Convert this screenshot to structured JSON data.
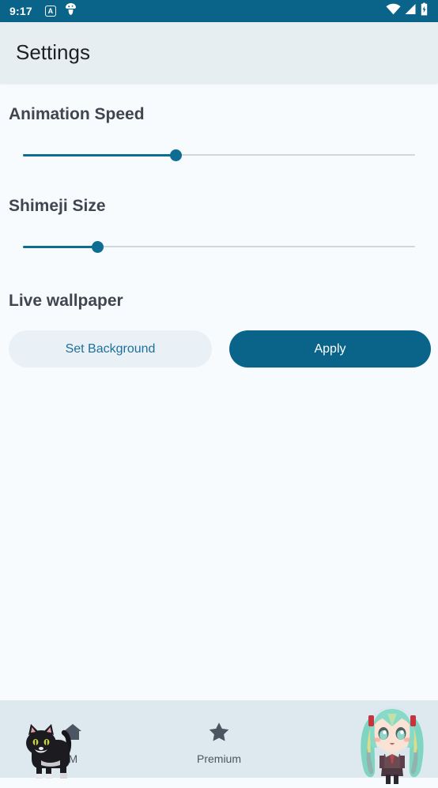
{
  "status_bar": {
    "time": "9:17",
    "left_icons": [
      {
        "name": "a-badge-icon",
        "glyph": "A"
      },
      {
        "name": "mushroom-notification-icon",
        "glyph": "mushroom"
      }
    ],
    "right_icons": [
      {
        "name": "wifi-icon",
        "glyph": "wifi"
      },
      {
        "name": "cellular-signal-icon",
        "glyph": "signal"
      },
      {
        "name": "battery-charging-icon",
        "glyph": "battery-bolt"
      }
    ],
    "background_color": "#0a6489",
    "foreground_color": "#ffffff"
  },
  "app_bar": {
    "title": "Settings",
    "background_color": "#e6eef2",
    "title_color": "#1d2024"
  },
  "settings": {
    "animation_speed": {
      "label": "Animation Speed",
      "value_percent": 39
    },
    "shimeji_size": {
      "label": "Shimeji Size",
      "value_percent": 19
    },
    "live_wallpaper": {
      "label": "Live wallpaper",
      "set_background_label": "Set Background",
      "apply_label": "Apply"
    }
  },
  "theme": {
    "accent": "#0a6489",
    "slider_active": "#0f6c92",
    "slider_inactive": "#d4d7d9",
    "heading": "#41454f",
    "body_background": "#f7fbfd",
    "nav_background": "#dde9ee",
    "nav_foreground": "#4c5663",
    "outline_button_background": "#eaf1f6",
    "outline_button_text": "#1d6f9c"
  },
  "bottom_nav": {
    "items": [
      {
        "label": "M",
        "icon": "home-icon",
        "sprite": "black-cat-sprite"
      },
      {
        "label": "Premium",
        "icon": "star-icon",
        "sprite": null
      },
      {
        "label": "",
        "icon": "shimeji-icon",
        "sprite": "miku-shimeji-sprite"
      }
    ]
  }
}
